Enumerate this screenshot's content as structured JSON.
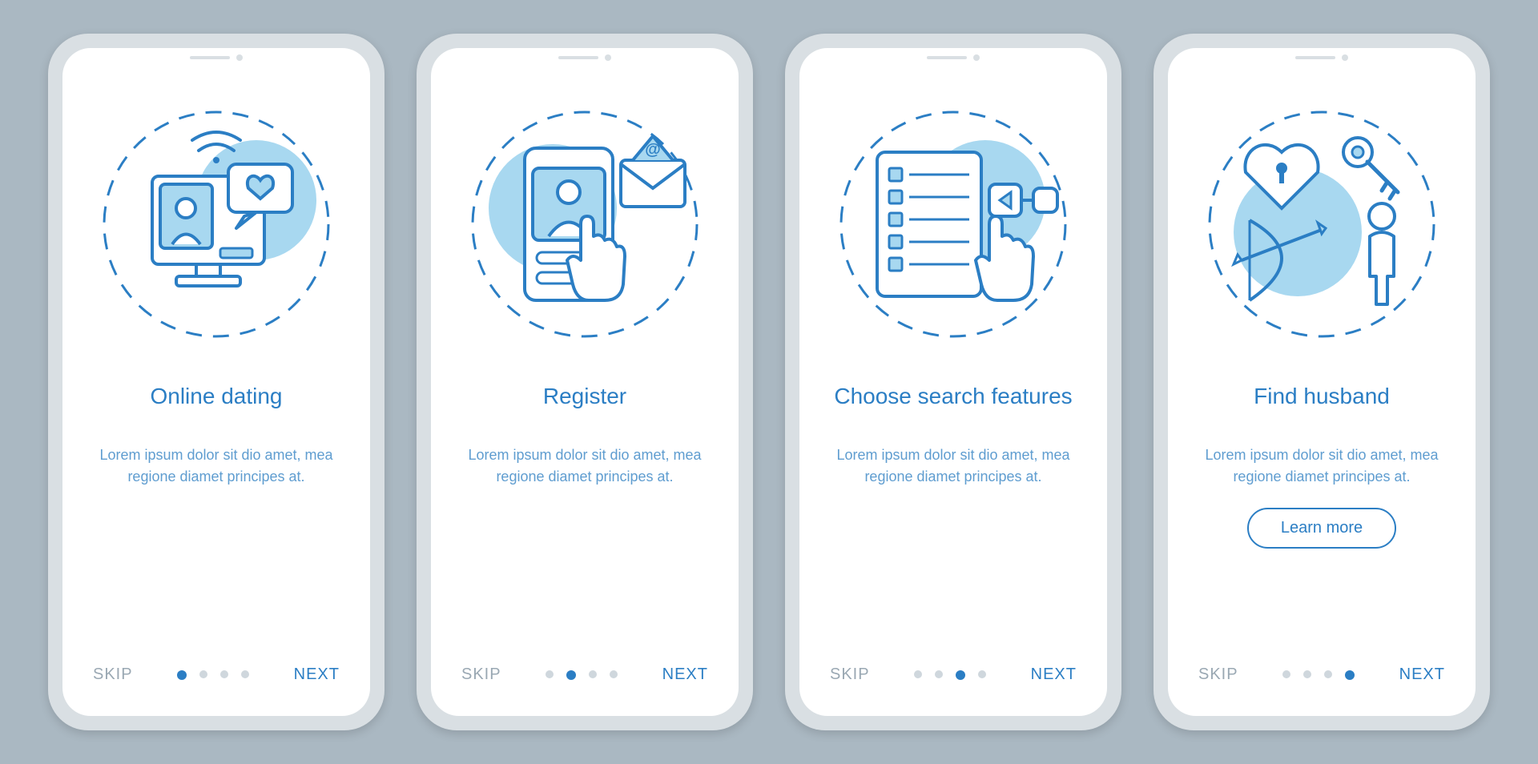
{
  "colors": {
    "primary": "#2b7ec4",
    "accent_light": "#a8d8f0",
    "muted": "#9aa8b3",
    "background": "#aab8c2"
  },
  "common": {
    "skip_label": "SKIP",
    "next_label": "NEXT",
    "learn_more_label": "Learn more",
    "description": "Lorem ipsum dolor sit dio amet, mea regione diamet principes at."
  },
  "screens": [
    {
      "title": "Online dating",
      "active_dot": 0,
      "has_learn_more": false,
      "illustration": "online-dating"
    },
    {
      "title": "Register",
      "active_dot": 1,
      "has_learn_more": false,
      "illustration": "register"
    },
    {
      "title": "Choose search features",
      "active_dot": 2,
      "has_learn_more": false,
      "illustration": "search-features"
    },
    {
      "title": "Find husband",
      "active_dot": 3,
      "has_learn_more": true,
      "illustration": "find-husband"
    }
  ]
}
